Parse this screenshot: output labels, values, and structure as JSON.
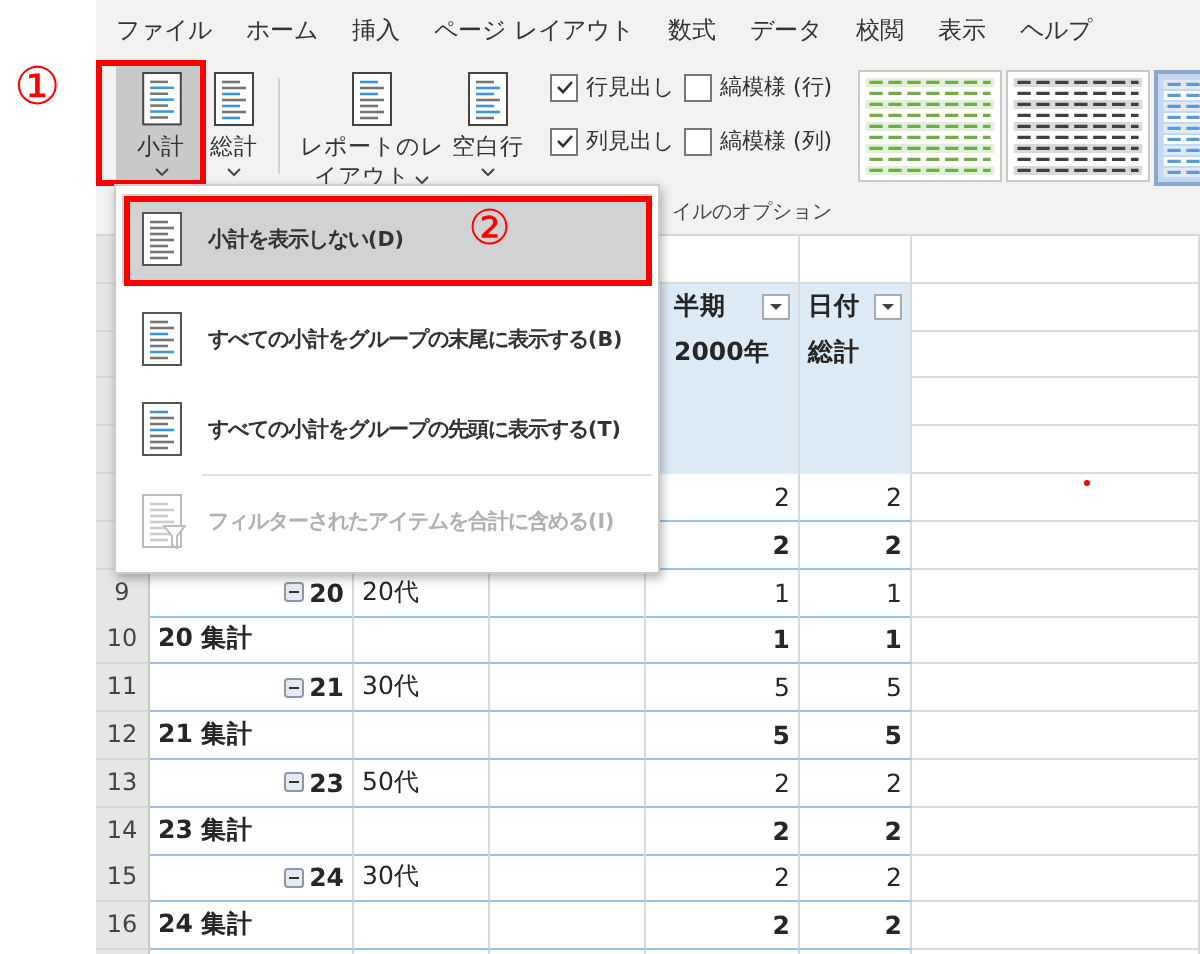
{
  "annotations": {
    "step_one": "①",
    "step_two": "②"
  },
  "ribbon_tabs": [
    {
      "label": "ファイル"
    },
    {
      "label": "ホーム"
    },
    {
      "label": "挿入"
    },
    {
      "label": "ページ レイアウト"
    },
    {
      "label": "数式"
    },
    {
      "label": "データ"
    },
    {
      "label": "校閲"
    },
    {
      "label": "表示"
    },
    {
      "label": "ヘルプ"
    }
  ],
  "layout_buttons": [
    {
      "kind": "subtotal",
      "label_lines": [
        "小計"
      ],
      "selected": true
    },
    {
      "kind": "grandtotal",
      "label_lines": [
        "総計"
      ],
      "selected": false
    },
    {
      "kind": "report",
      "label_lines": [
        "レポートのレ",
        "イアウト"
      ],
      "selected": false
    },
    {
      "kind": "blank",
      "label_lines": [
        "空白行"
      ],
      "selected": false
    }
  ],
  "style_options": {
    "checkboxes": [
      {
        "label": "行見出し",
        "checked": true
      },
      {
        "label": "縞模様 (行)",
        "checked": false
      },
      {
        "label": "列見出し",
        "checked": true
      },
      {
        "label": "縞模様 (列)",
        "checked": false
      }
    ],
    "group_label": "イルのオプション"
  },
  "style_gallery": [
    {
      "kind": "green",
      "selected": false
    },
    {
      "kind": "dark",
      "selected": false
    },
    {
      "kind": "blue",
      "selected": true
    }
  ],
  "subtotal_menu": {
    "items": [
      {
        "kind": "none",
        "label": "小計を表示しない(D)",
        "selected": true,
        "disabled": false
      },
      {
        "kind": "bottom",
        "label": "すべての小計をグループの末尾に表示する(B)",
        "selected": false,
        "disabled": false
      },
      {
        "kind": "top",
        "label": "すべての小計をグループの先頭に表示する(T)",
        "selected": false,
        "disabled": false
      },
      {
        "kind": "filter",
        "label": "フィルターされたアイテムを合計に含める(I)",
        "selected": false,
        "disabled": true
      }
    ]
  },
  "sheet": {
    "rows": [
      {
        "kind": "blank"
      },
      {
        "kind": "header",
        "values": [
          "半期",
          "日付"
        ],
        "filters": true
      },
      {
        "kind": "header",
        "values": [
          "2000年",
          "総計"
        ]
      },
      {
        "kind": "header"
      },
      {
        "kind": "header"
      },
      {
        "kind": "detail",
        "values": [
          "2",
          "2"
        ]
      },
      {
        "kind": "total",
        "values": [
          "2",
          "2"
        ]
      },
      {
        "kind": "detail",
        "number": "9",
        "group": "20",
        "age": "20代",
        "values": [
          "1",
          "1"
        ]
      },
      {
        "kind": "total",
        "number": "10",
        "label": "20 集計",
        "values": [
          "1",
          "1"
        ]
      },
      {
        "kind": "detail",
        "number": "11",
        "group": "21",
        "age": "30代",
        "values": [
          "5",
          "5"
        ]
      },
      {
        "kind": "total",
        "number": "12",
        "label": "21 集計",
        "values": [
          "5",
          "5"
        ]
      },
      {
        "kind": "detail",
        "number": "13",
        "group": "23",
        "age": "50代",
        "values": [
          "2",
          "2"
        ]
      },
      {
        "kind": "total",
        "number": "14",
        "label": "23 集計",
        "values": [
          "2",
          "2"
        ]
      },
      {
        "kind": "detail",
        "number": "15",
        "group": "24",
        "age": "30代",
        "values": [
          "2",
          "2"
        ]
      },
      {
        "kind": "total",
        "number": "16",
        "label": "24 集計",
        "values": [
          "2",
          "2"
        ]
      },
      {
        "kind": "blank"
      }
    ]
  }
}
